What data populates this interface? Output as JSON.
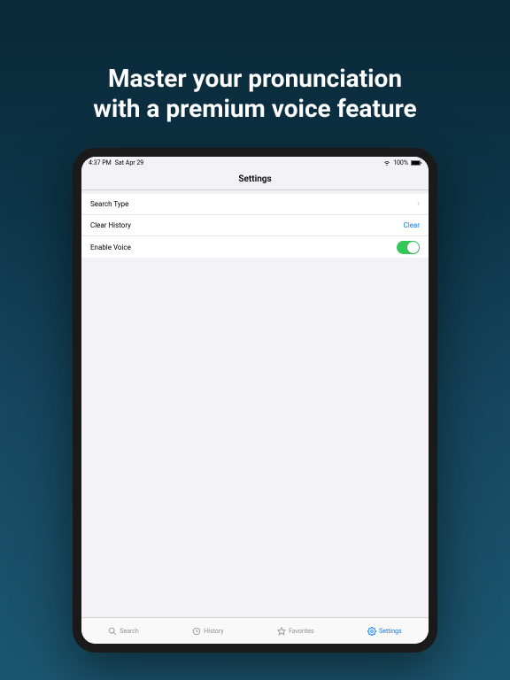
{
  "headline": {
    "line1": "Master your pronunciation",
    "line2": "with a premium voice feature"
  },
  "status": {
    "time": "4:37 PM",
    "date": "Sat Apr 29",
    "battery": "100%"
  },
  "header": {
    "title": "Settings"
  },
  "settings": {
    "search_type": {
      "label": "Search Type"
    },
    "clear_history": {
      "label": "Clear History",
      "action": "Clear"
    },
    "enable_voice": {
      "label": "Enable Voice",
      "enabled": true
    }
  },
  "tabs": {
    "search": "Search",
    "history": "History",
    "favorites": "Favorites",
    "settings": "Settings"
  }
}
